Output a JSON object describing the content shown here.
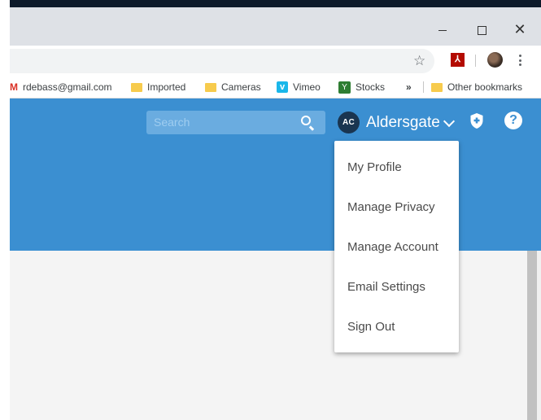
{
  "window_controls": {
    "minimize": "–",
    "maximize": "☐",
    "close": "✕"
  },
  "toolbar": {
    "bookmark_star": "☆",
    "pdf_extension": "ﾉ",
    "menu": "⋮"
  },
  "bookmarks": {
    "items": [
      {
        "label": "rdebass@gmail.com",
        "icon": "gmail-icon"
      },
      {
        "label": "Imported",
        "icon": "folder-icon"
      },
      {
        "label": "Cameras",
        "icon": "folder-icon"
      },
      {
        "label": "Vimeo",
        "icon": "vimeo-icon"
      },
      {
        "label": "Stocks",
        "icon": "stocks-icon"
      }
    ],
    "overflow": "»",
    "other": "Other bookmarks"
  },
  "header": {
    "search_placeholder": "Search",
    "account_initials": "AC",
    "account_name": "Aldersgate",
    "help": "?",
    "brand_color": "#3b8fd1"
  },
  "dropdown": {
    "items": [
      "My Profile",
      "Manage Privacy",
      "Manage Account",
      "Email Settings",
      "Sign Out"
    ]
  }
}
